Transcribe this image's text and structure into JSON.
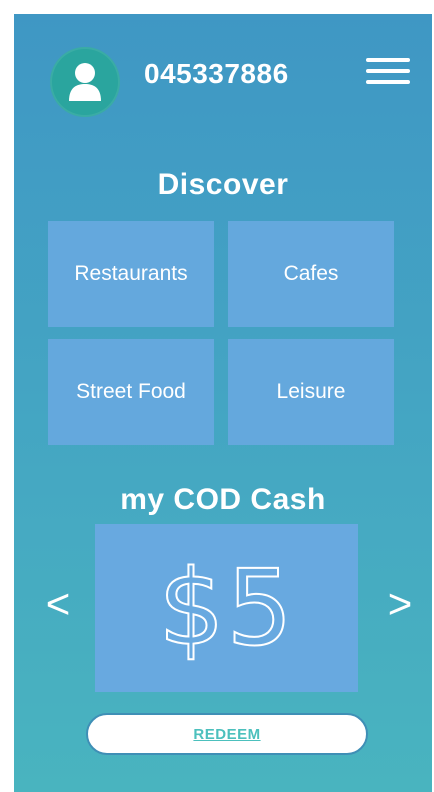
{
  "header": {
    "phone_number": "045337886",
    "avatar_icon": "user-avatar-icon",
    "menu_icon": "hamburger-menu-icon"
  },
  "discover": {
    "title": "Discover",
    "categories": [
      {
        "label": "Restaurants"
      },
      {
        "label": "Cafes"
      },
      {
        "label": "Street Food"
      },
      {
        "label": "Leisure"
      }
    ]
  },
  "cash": {
    "title": "my COD Cash",
    "amount": "$5",
    "prev_label": "<",
    "next_label": ">"
  },
  "redeem": {
    "label": "REDEEM"
  },
  "colors": {
    "background_top": "#3f97c4",
    "background_bottom": "#49b4bf",
    "tile": "#64a8dd",
    "avatar": "#2aa59e",
    "redeem_text": "#4cc0bd"
  }
}
